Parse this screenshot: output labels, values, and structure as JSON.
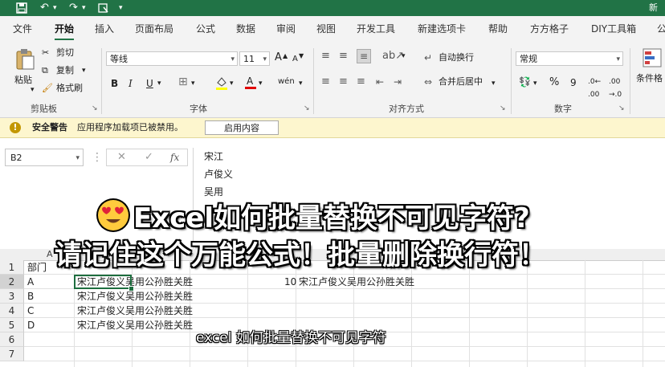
{
  "title_bar": {
    "right_text": "新",
    "accent": "#217346"
  },
  "qat": {
    "save_icon": "save-icon",
    "undo_icon": "undo-icon",
    "redo_icon": "redo-icon",
    "autosave_icon": "touch-mode-icon",
    "more_icon": "customize-qat-icon"
  },
  "menu": {
    "tabs": [
      {
        "label": "文件"
      },
      {
        "label": "开始",
        "active": true
      },
      {
        "label": "插入"
      },
      {
        "label": "页面布局"
      },
      {
        "label": "公式"
      },
      {
        "label": "数据"
      },
      {
        "label": "审阅"
      },
      {
        "label": "视图"
      },
      {
        "label": "开发工具"
      },
      {
        "label": "新建选项卡"
      },
      {
        "label": "帮助"
      },
      {
        "label": "方方格子"
      },
      {
        "label": "DIY工具箱"
      },
      {
        "label": "公"
      }
    ]
  },
  "ribbon": {
    "clipboard": {
      "paste": "粘贴",
      "cut": "剪切",
      "copy": "复制",
      "format_painter": "格式刷",
      "group": "剪贴板"
    },
    "font": {
      "name": "等线",
      "size": "11",
      "grow": "A",
      "shrink": "A",
      "bold": "B",
      "italic": "I",
      "underline": "U",
      "group": "字体"
    },
    "alignment": {
      "wrap": "自动换行",
      "merge": "合并后居中",
      "group": "对齐方式"
    },
    "number": {
      "format": "常规",
      "percent": "%",
      "comma": "9",
      "group": "数字"
    },
    "styles": {
      "conditional": "条件格"
    }
  },
  "warning": {
    "label": "安全警告",
    "message": "应用程序加载项已被禁用。",
    "button": "启用内容"
  },
  "formula_bar": {
    "name_box": "B2",
    "fx": "fx",
    "lines": [
      "宋江",
      "卢俊义",
      "吴用"
    ]
  },
  "grid": {
    "col_a_label": "A",
    "rows": [
      {
        "num": "1",
        "a": "部门",
        "b": "",
        "c": "",
        "d": ""
      },
      {
        "num": "2",
        "a": "A",
        "b": "宋江卢俊义吴用公孙胜关胜",
        "c": "10",
        "d": "宋江卢俊义吴用公孙胜关胜"
      },
      {
        "num": "3",
        "a": "B",
        "b": "宋江卢俊义吴用公孙胜关胜",
        "c": "",
        "d": ""
      },
      {
        "num": "4",
        "a": "C",
        "b": "宋江卢俊义吴用公孙胜关胜",
        "c": "",
        "d": ""
      },
      {
        "num": "5",
        "a": "D",
        "b": "宋江卢俊义吴用公孙胜关胜",
        "c": "",
        "d": ""
      },
      {
        "num": "6",
        "a": "",
        "b": "",
        "c": "",
        "d": ""
      },
      {
        "num": "7",
        "a": "",
        "b": "",
        "c": "",
        "d": ""
      }
    ]
  },
  "overlay": {
    "emoji": "heart-eyes-emoji",
    "line1": "Excel如何批量替换不可见字符?",
    "line2": "请记住这个万能公式！批量删除换行符！",
    "subtitle": "excel 如何批量替换不可见字符"
  }
}
